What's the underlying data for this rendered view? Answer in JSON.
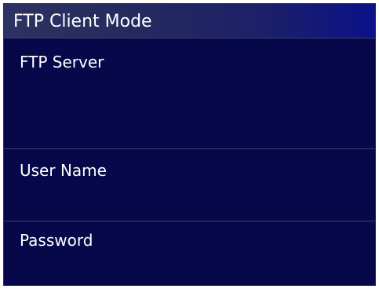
{
  "header": {
    "title": "FTP Client Mode"
  },
  "fields": [
    {
      "label": "FTP Server",
      "value": ""
    },
    {
      "label": "User Name",
      "value": ""
    },
    {
      "label": "Password",
      "value": ""
    }
  ],
  "colors": {
    "background": "#07084a",
    "title_bar_start": "#2d3262",
    "title_bar_end": "#0b118a",
    "divider": "#3a3d72",
    "text": "#ffffff"
  }
}
